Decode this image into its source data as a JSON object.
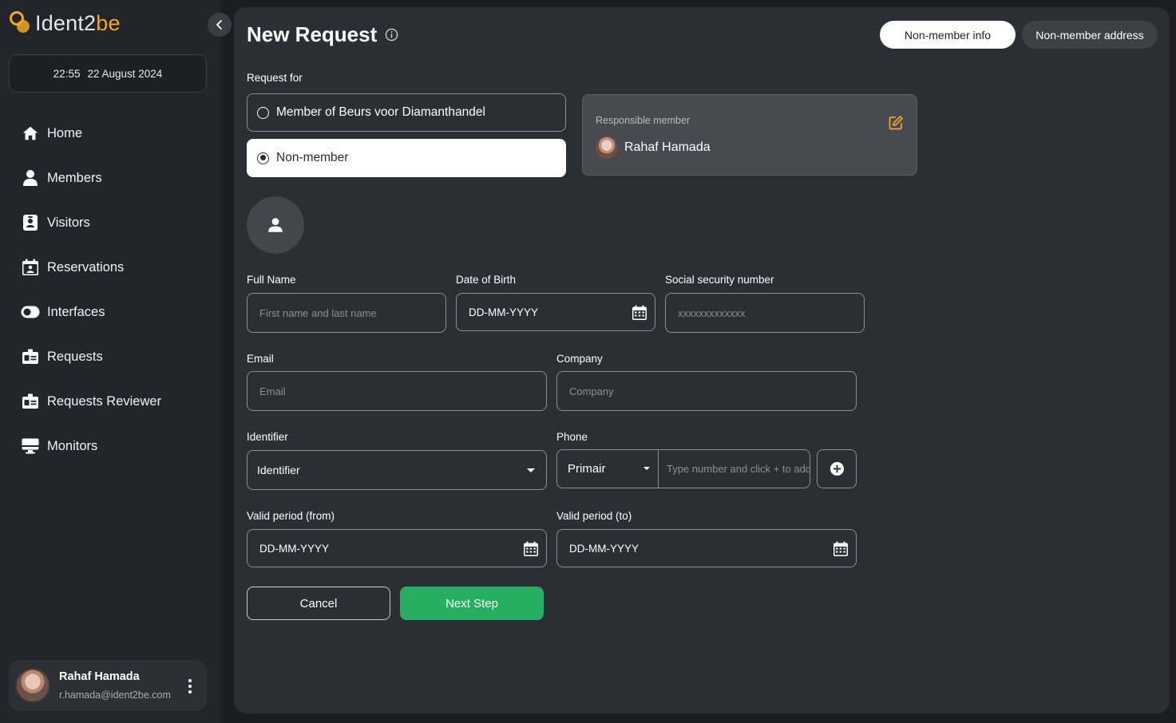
{
  "app": {
    "brand_prefix": "Ident2",
    "brand_accent": "be",
    "time": "22:55",
    "date": "22 August 2024"
  },
  "sidebar": {
    "items": [
      {
        "label": "Home",
        "icon": "home-icon"
      },
      {
        "label": "Members",
        "icon": "person-icon"
      },
      {
        "label": "Visitors",
        "icon": "badge-icon"
      },
      {
        "label": "Reservations",
        "icon": "calendar-person-icon"
      },
      {
        "label": "Interfaces",
        "icon": "toggle-icon"
      },
      {
        "label": "Requests",
        "icon": "id-card-icon"
      },
      {
        "label": "Requests Reviewer",
        "icon": "id-card-icon"
      },
      {
        "label": "Monitors",
        "icon": "monitor-icon"
      }
    ]
  },
  "user": {
    "name": "Rahaf Hamada",
    "email": "r.hamada@ident2be.com"
  },
  "page": {
    "title": "New Request",
    "tabs": [
      {
        "label": "Non-member info",
        "active": true
      },
      {
        "label": "Non-member address",
        "active": false
      }
    ],
    "request_for_label": "Request for",
    "options": [
      {
        "label": "Member of Beurs voor Diamanthandel",
        "selected": false
      },
      {
        "label": "Non-member",
        "selected": true
      }
    ],
    "responsible": {
      "label": "Responsible member",
      "name": "Rahaf Hamada"
    }
  },
  "form": {
    "full_name": {
      "label": "Full Name",
      "placeholder": "First name and last name"
    },
    "dob": {
      "label": "Date of Birth",
      "value": "DD-MM-YYYY"
    },
    "ssn": {
      "label": "Social security number",
      "placeholder": "xxxxxxxxxxxxx"
    },
    "email": {
      "label": "Email",
      "placeholder": "Email"
    },
    "company": {
      "label": "Company",
      "placeholder": "Company"
    },
    "identifier": {
      "label": "Identifier",
      "value": "Identifier"
    },
    "phone": {
      "label": "Phone",
      "type": "Primair",
      "placeholder": "Type number and click + to add"
    },
    "valid_from": {
      "label": "Valid period (from)",
      "value": "DD-MM-YYYY"
    },
    "valid_to": {
      "label": "Valid period (to)",
      "value": "DD-MM-YYYY"
    }
  },
  "actions": {
    "cancel": "Cancel",
    "next": "Next Step"
  },
  "colors": {
    "accent": "#f5a623",
    "primary_green": "#27ae60",
    "panel": "#2b2e35",
    "sidebar": "#22252b"
  }
}
